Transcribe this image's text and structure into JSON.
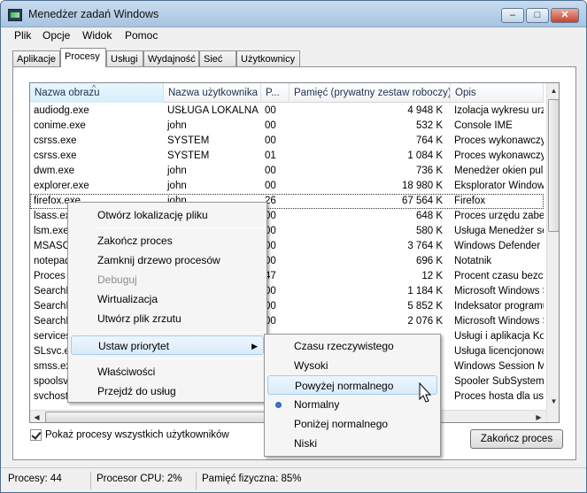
{
  "window": {
    "title": "Menedżer zadań Windows",
    "minimize": "–",
    "maximize": "□",
    "close": "✕"
  },
  "menu": [
    "Plik",
    "Opcje",
    "Widok",
    "Pomoc"
  ],
  "tabs": [
    "Aplikacje",
    "Procesy",
    "Usługi",
    "Wydajność",
    "Sieć",
    "Użytkownicy"
  ],
  "active_tab": "Procesy",
  "table": {
    "columns": [
      "Nazwa obrazu",
      "Nazwa użytkownika",
      "P...",
      "Pamięć (prywatny zestaw roboczy)",
      "Opis"
    ],
    "rows": [
      {
        "name": "audiodg.exe",
        "user": "USŁUGA LOKALNA",
        "cpu": "00",
        "mem": "4 948 K",
        "desc": "Izolacja wykresu urządzenia audio"
      },
      {
        "name": "conime.exe",
        "user": "john",
        "cpu": "00",
        "mem": "532 K",
        "desc": "Console IME"
      },
      {
        "name": "csrss.exe",
        "user": "SYSTEM",
        "cpu": "00",
        "mem": "764 K",
        "desc": "Proces wykonawczy klient-serwer"
      },
      {
        "name": "csrss.exe",
        "user": "SYSTEM",
        "cpu": "01",
        "mem": "1 084 K",
        "desc": "Proces wykonawczy klient-serwer"
      },
      {
        "name": "dwm.exe",
        "user": "john",
        "cpu": "00",
        "mem": "736 K",
        "desc": "Menedżer okien pulpitu"
      },
      {
        "name": "explorer.exe",
        "user": "john",
        "cpu": "00",
        "mem": "18 980 K",
        "desc": "Eksplorator Windows"
      },
      {
        "name": "firefox.exe",
        "user": "john",
        "cpu": "26",
        "mem": "67 564 K",
        "desc": "Firefox"
      },
      {
        "name": "lsass.exe",
        "user": "",
        "cpu": "00",
        "mem": "648 K",
        "desc": "Proces urzędu zabezpieczeń lokalnych"
      },
      {
        "name": "lsm.exe",
        "user": "",
        "cpu": "00",
        "mem": "580 K",
        "desc": "Usługa Menedżer sesji lokalnych"
      },
      {
        "name": "MSASCui.exe",
        "user": "",
        "cpu": "00",
        "mem": "3 764 K",
        "desc": "Windows Defender User Interface"
      },
      {
        "name": "notepad.exe",
        "user": "",
        "cpu": "00",
        "mem": "696 K",
        "desc": "Notatnik"
      },
      {
        "name": "Proces bezczynności",
        "user": "",
        "cpu": "47",
        "mem": "12 K",
        "desc": "Procent czasu bezczynności procesora"
      },
      {
        "name": "SearchFilterHost.exe",
        "user": "",
        "cpu": "00",
        "mem": "1 184 K",
        "desc": "Microsoft Windows Search Filter Host"
      },
      {
        "name": "SearchIndexer.exe",
        "user": "",
        "cpu": "00",
        "mem": "5 852 K",
        "desc": "Indeksator programu Microsoft Windows Search"
      },
      {
        "name": "SearchProtocolHost.exe",
        "user": "",
        "cpu": "00",
        "mem": "2 076 K",
        "desc": "Microsoft Windows Search Protocol Host"
      },
      {
        "name": "services.exe",
        "user": "",
        "cpu": "",
        "mem": "",
        "desc": "Usługi i aplikacja Kontroler"
      },
      {
        "name": "SLsvc.exe",
        "user": "",
        "cpu": "",
        "mem": "",
        "desc": "Usługa licencjonowania oprogramowania"
      },
      {
        "name": "smss.exe",
        "user": "",
        "cpu": "",
        "mem": "",
        "desc": "Windows Session Manager"
      },
      {
        "name": "spoolsv.exe",
        "user": "",
        "cpu": "",
        "mem": "",
        "desc": "Spooler SubSystem App"
      },
      {
        "name": "svchost.exe",
        "user": "",
        "cpu": "",
        "mem": "",
        "desc": "Proces hosta dla usług systemu Windows"
      }
    ]
  },
  "show_all_users": "Pokaż procesy wszystkich użytkowników",
  "end_process_button": "Zakończ proces",
  "status": {
    "processes": "Procesy: 44",
    "cpu": "Procesor CPU: 2%",
    "memory": "Pamięć fizyczna: 85%"
  },
  "context_menu": {
    "items": [
      "Otwórz lokalizację pliku",
      "Zakończ proces",
      "Zamknij drzewo procesów",
      "Debuguj",
      "Wirtualizacja",
      "Utwórz plik zrzutu",
      "Ustaw priorytet",
      "Właściwości",
      "Przejdź do usług"
    ]
  },
  "priority_menu": {
    "items": [
      "Czasu rzeczywistego",
      "Wysoki",
      "Powyżej normalnego",
      "Normalny",
      "Poniżej normalnego",
      "Niski"
    ],
    "selected": "Normalny",
    "hovered": "Powyżej normalnego"
  }
}
